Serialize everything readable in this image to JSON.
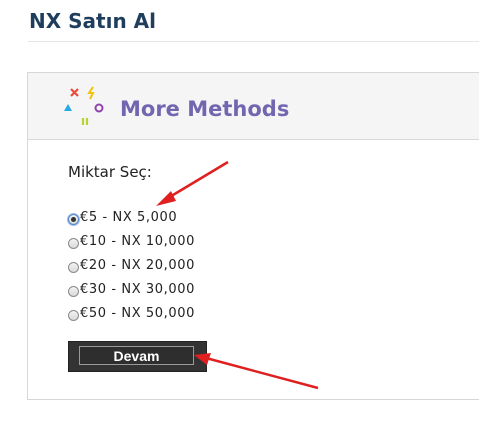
{
  "page": {
    "title": "NX Satın Al"
  },
  "methods": {
    "title": "More Methods"
  },
  "form": {
    "amount_label": "Miktar Seç:",
    "options": [
      {
        "label": "€5 - NX 5,000",
        "checked": true
      },
      {
        "label": "€10 - NX 10,000",
        "checked": false
      },
      {
        "label": "€20 - NX 20,000",
        "checked": false
      },
      {
        "label": "€30 - NX 30,000",
        "checked": false
      },
      {
        "label": "€50 - NX 50,000",
        "checked": false
      }
    ],
    "submit_label": "Devam"
  },
  "annotations": {
    "arrow_color": "#e02020"
  },
  "logo_colors": {
    "cross": "#e84c3d",
    "bolt": "#f4c20d",
    "triangle": "#27a9e1",
    "circle": "#8e44ad",
    "bars": "#b7d433"
  }
}
